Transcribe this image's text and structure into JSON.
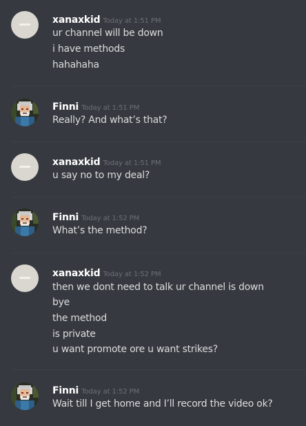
{
  "messages": [
    {
      "author": "xanaxkid",
      "timestamp": "Today at 1:51 PM",
      "avatar": "default",
      "lines": [
        "ur channel will be down",
        "i have methods",
        "hahahaha"
      ]
    },
    {
      "author": "Finni",
      "timestamp": "Today at 1:51 PM",
      "avatar": "pixel",
      "lines": [
        "Really? And what’s that?"
      ]
    },
    {
      "author": "xanaxkid",
      "timestamp": "Today at 1:51 PM",
      "avatar": "default",
      "lines": [
        "u say no to my deal?"
      ]
    },
    {
      "author": "Finni",
      "timestamp": "Today at 1:52 PM",
      "avatar": "pixel",
      "lines": [
        "What’s the method?"
      ]
    },
    {
      "author": "xanaxkid",
      "timestamp": "Today at 1:52 PM",
      "avatar": "default",
      "lines": [
        "then we dont need to talk ur channel is down",
        "bye",
        "the method",
        "is private",
        "u want promote ore u want strikes?"
      ]
    },
    {
      "author": "Finni",
      "timestamp": "Today at 1:52 PM",
      "avatar": "pixel",
      "lines": [
        "Wait till I get home and I’ll record the video ok?"
      ]
    }
  ]
}
